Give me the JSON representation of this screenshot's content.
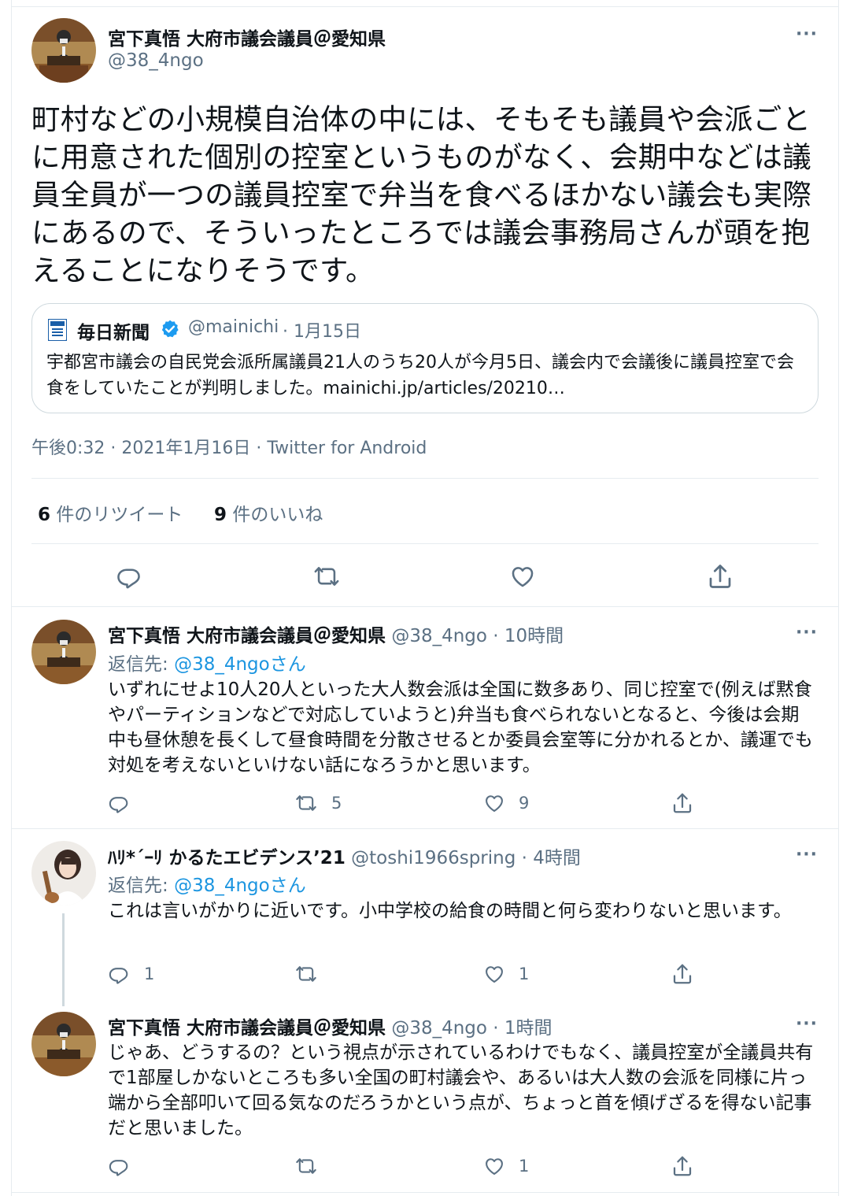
{
  "main_tweet": {
    "display_name": "宮下真悟 大府市議会議員＠愛知県",
    "handle": "@38_4ngo",
    "text": "町村などの小規模自治体の中には、そもそも議員や会派ごとに用意された個別の控室というものがなく、会期中などは議員全員が一つの議員控室で弁当を食べるほかない議会も実際にあるので、そういったところでは議会事務局さんが頭を抱えることになりそうです。",
    "quote": {
      "display_name": "毎日新聞",
      "handle": "@mainichi",
      "date": "· 1月15日",
      "text": "宇都宮市議会の自民党会派所属議員21人のうち20人が今月5日、議会内で会議後に議員控室で会食をしていたことが判明しました。mainichi.jp/articles/20210…"
    },
    "timestamp": "午後0:32 · 2021年1月16日 · ",
    "client": "Twitter for Android",
    "retweet_count": "6",
    "retweet_label": " 件のリツイート",
    "like_count": "9",
    "like_label": " 件のいいね"
  },
  "replies": [
    {
      "display_name": "宮下真悟 大府市議会議員＠愛知県",
      "handle": "@38_4ngo",
      "time": "· 10時間",
      "reply_to_prefix": "返信先: ",
      "reply_to_handle": "@38_4ngoさん",
      "text": "いずれにせよ10人20人といった大人数会派は全国に数多あり、同じ控室で(例えば黙食やパーティションなどで対応していようと)弁当も食べられないとなると、今後は会期中も昼休憩を長くして昼食時間を分散させるとか委員会室等に分かれるとか、議運でも対処を考えないといけない話になろうかと思います。",
      "reply_count": "",
      "retweet_count": "5",
      "like_count": "9"
    },
    {
      "display_name": "ﾊﾘ*´ｰﾘ かるたエビデンス’21",
      "handle": "@toshi1966spring",
      "time": "· 4時間",
      "reply_to_prefix": "返信先: ",
      "reply_to_handle": "@38_4ngoさん",
      "text": "これは言いがかりに近いです。小中学校の給食の時間と何ら変わりないと思います。",
      "reply_count": "1",
      "retweet_count": "",
      "like_count": "1"
    },
    {
      "display_name": "宮下真悟 大府市議会議員＠愛知県",
      "handle": "@38_4ngo",
      "time": "· 1時間",
      "text": "じゃあ、どうするの？という視点が示されているわけでもなく、議員控室が全議員共有で1部屋しかないところも多い全国の町村議会や、あるいは大人数の会派を同様に片っ端から全部叩いて回る気なのだろうかという点が、ちょっと首を傾げざるを得ない記事だと思いました。",
      "reply_count": "",
      "retweet_count": "",
      "like_count": "1"
    }
  ],
  "colors": {
    "text": "#0f1419",
    "secondary": "#5b7083",
    "link": "#1b95e0",
    "verified": "#1d9bf0",
    "border": "#e6ecf0"
  },
  "icons": [
    "more-icon",
    "reply-icon",
    "retweet-icon",
    "like-icon",
    "share-icon",
    "verified-icon",
    "mainichi-logo-icon"
  ]
}
